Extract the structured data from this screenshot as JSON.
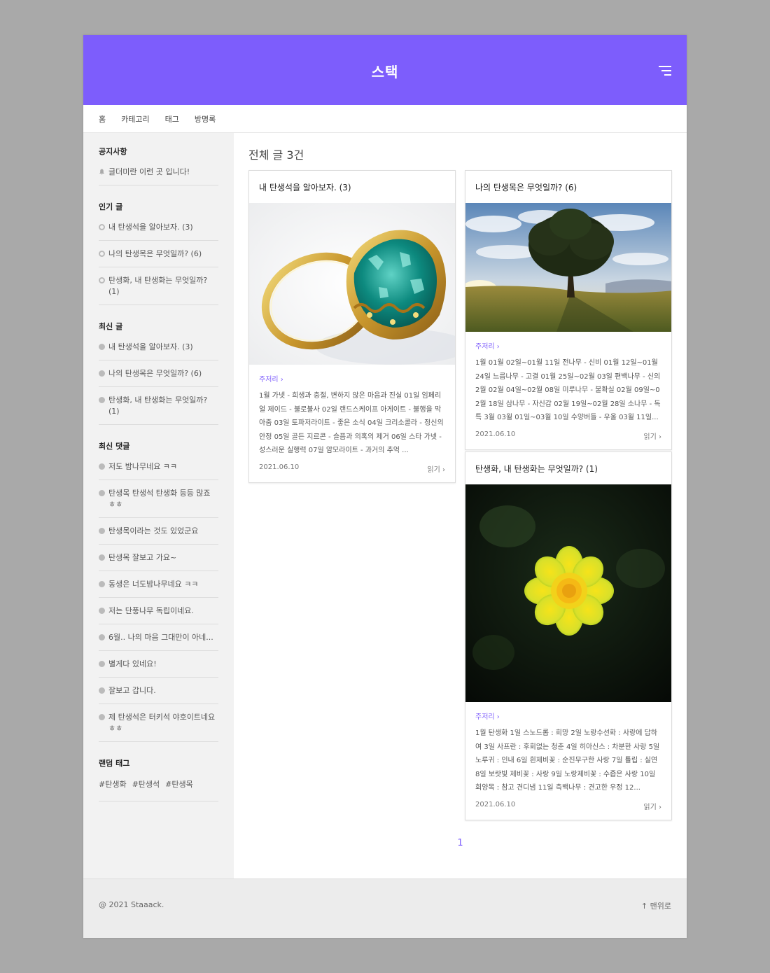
{
  "header": {
    "title": "스택"
  },
  "gnb": [
    "홈",
    "카테고리",
    "태그",
    "방명록"
  ],
  "sidebar": {
    "notice": {
      "title": "공지사항",
      "items": [
        "글더미란 이런 곳 입니다!"
      ]
    },
    "popular": {
      "title": "인기 글",
      "items": [
        "내 탄생석을 알아보자. (3)",
        "나의 탄생목은 무엇일까? (6)",
        "탄생화, 내 탄생화는 무엇일까? (1)"
      ]
    },
    "recent": {
      "title": "최신 글",
      "items": [
        "내 탄생석을 알아보자. (3)",
        "나의 탄생목은 무엇일까? (6)",
        "탄생화, 내 탄생화는 무엇일까? (1)"
      ]
    },
    "comments": {
      "title": "최신 댓글",
      "items": [
        "저도 밤나무네요 ㅋㅋ",
        "탄생목 탄생석 탄생화 등등 많죠 ㅎㅎ",
        "탄생목이라는 것도 있었군요",
        "탄생목 잘보고 가요~",
        "동생은 너도밤나무네요 ㅋㅋ",
        "저는 단풍나무 독립이네요.",
        "6월.. 나의 마음 그대만이 아네...",
        "별게다 있네요!",
        "잘보고 갑니다.",
        "제 탄생석은 터키석 야호이트네요 ㅎㅎ"
      ]
    },
    "tags": {
      "title": "랜덤 태그",
      "items": [
        "#탄생화",
        "#탄생석",
        "#탄생목"
      ]
    }
  },
  "main": {
    "title": "전체 글 3건",
    "cards": [
      {
        "title": "내 탄생석을 알아보자. (3)",
        "category": "주저리 ›",
        "text": "1월 가넷 - 희생과 충절, 변하지 않은 마음과 진실 01일 임페리얼 제이드 - 불로불사 02일 랜드스케이프 아게이트 - 불행을 막아줌 03일 토파저라이트 - 좋은 소식 04일 크리소콜라 - 정신의 안정 05일 골든 지르콘 - 슬픔과 의혹의 제거 06일 스타 가넷 - 성스러운 실행력 07일 암모라이트 - 과거의 추억 ...",
        "date": "2021.06.10",
        "read": "읽기 ›"
      },
      {
        "title": "나의 탄생목은 무엇일까? (6)",
        "category": "주저리 ›",
        "text": "1월 01월 02일~01월 11일 전나무 - 신비 01월 12일~01월 24일 느릅나무 - 고결 01월 25일~02월 03일 편백나무 - 신의 2월 02월 04일~02월 08일 미루나무 - 불확실 02월 09일~02월 18일 삼나무 - 자신감 02월 19일~02월 28일 소나무 - 독특 3월 03월 01일~03월 10일 수양버들 - 우울 03월 11일...",
        "date": "2021.06.10",
        "read": "읽기 ›"
      },
      {
        "title": "탄생화, 내 탄생화는 무엇일까? (1)",
        "category": "주저리 ›",
        "text": "1월 탄생화 1일 스노드롭 : 희망 2일 노랑수선화 : 사랑에 답하여 3일 사프란 : 후회없는 청춘 4일 히아신스 : 차분한 사랑 5일 노루귀 : 인내 6일 흰제비꽃 : 순진무구한 사랑 7일 튤립 : 실연 8일 보랏빛 제비꽃 : 사랑 9일 노랑제비꽃 : 수줍은 사랑 10일 회양목 : 참고 견디냄 11일 측백나무 : 견고한 우정 12...",
        "date": "2021.06.10",
        "read": "읽기 ›"
      }
    ],
    "pager": "1"
  },
  "footer": {
    "copyright": "@ 2021 Staaack.",
    "totop": "↑ 맨위로"
  }
}
